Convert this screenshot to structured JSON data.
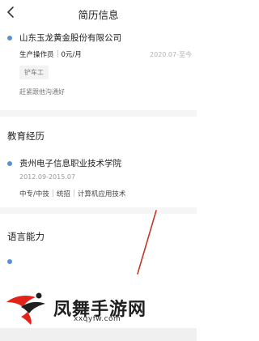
{
  "header": {
    "title": "简历信息",
    "back_icon": "chevron-left-icon"
  },
  "work": {
    "company": "山东玉龙黄金股份有限公司",
    "position": "生产操作员",
    "salary": "0元/月",
    "date": "2020.07-至今",
    "tag": "铲车工",
    "description": "赶紧跟他沟通好"
  },
  "education": {
    "section_title": "教育经历",
    "school": "贵州电子信息职业技术学院",
    "date": "2012.09-2015.07",
    "degree": "中专/中技",
    "type": "统招",
    "major": "计算机应用技术"
  },
  "language": {
    "section_title": "语言能力"
  },
  "watermark": {
    "text": "凤舞手游网",
    "url": "xxqyfw.com",
    "colors": {
      "red": "#e2231a",
      "black": "#1f1f1f"
    }
  },
  "colors": {
    "accent_dot": "#5b8fd6",
    "divider": "#f5f5f5"
  }
}
